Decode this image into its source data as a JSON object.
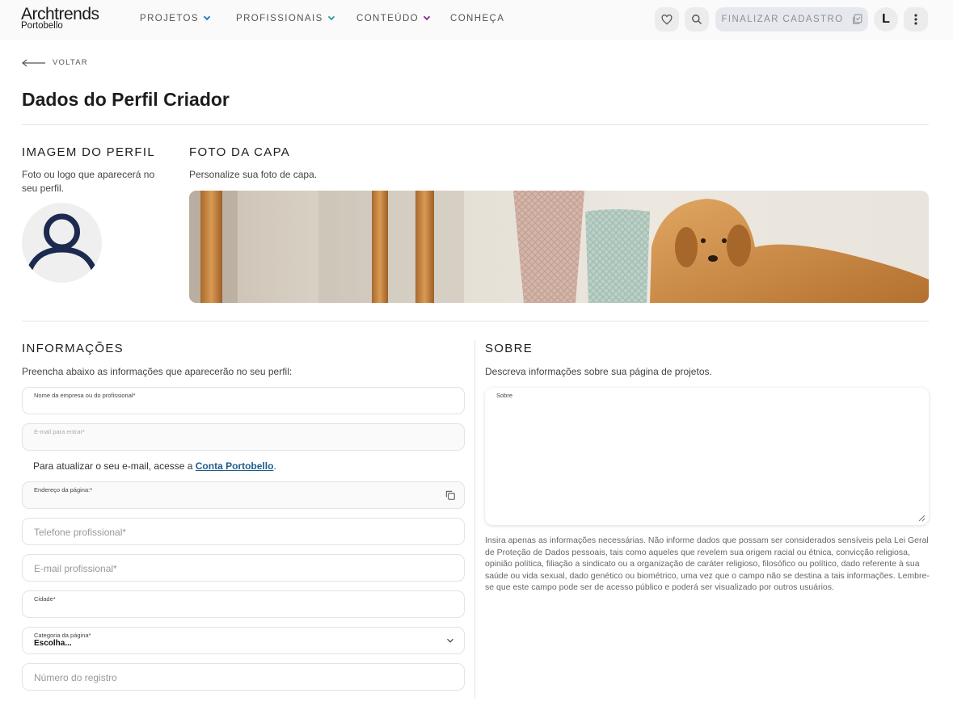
{
  "header": {
    "logo_line1": "Archtrends",
    "logo_line2": "Portobello",
    "nav": [
      {
        "label": "PROJETOS",
        "chevron_color": "#2b7fb8"
      },
      {
        "label": "PROFISSIONAIS",
        "chevron_color": "#3aa39a"
      },
      {
        "label": "CONTEÚDO",
        "chevron_color": "#8a3a8c"
      },
      {
        "label": "CONHEÇA"
      }
    ],
    "finalizar_label": "FINALIZAR CADASTRO",
    "user_initial": "L",
    "icons": [
      "heart-icon",
      "search-icon",
      "checklist-icon",
      "more-vertical-icon"
    ]
  },
  "back_label": "VOLTAR",
  "page_title": "Dados do Perfil Criador",
  "profile_image": {
    "title": "IMAGEM DO PERFIL",
    "desc": "Foto ou logo que aparecerá no seu perfil."
  },
  "cover": {
    "title": "FOTO DA CAPA",
    "desc": "Personalize sua foto de capa."
  },
  "info": {
    "title": "INFORMAÇÕES",
    "desc": "Preencha abaixo as informações que aparecerão no seu perfil:",
    "fields": {
      "company_name": {
        "label": "Nome da empresa ou do profissional*",
        "value": ""
      },
      "login_email": {
        "label": "E-mail para entrar*",
        "value": ""
      },
      "page_address": {
        "label": "Endereço da página:*",
        "value": ""
      },
      "phone": {
        "placeholder": "Telefone profissional*"
      },
      "pro_email": {
        "placeholder": "E-mail profissional*"
      },
      "city": {
        "label": "Cidade*",
        "value": ""
      },
      "category": {
        "label": "Categoria da página*",
        "value": "Escolha..."
      },
      "registry": {
        "placeholder": "Número do registro"
      }
    },
    "email_note_prefix": "Para atualizar o seu e-mail, acesse a ",
    "email_note_link": "Conta Portobello",
    "email_note_suffix": "."
  },
  "about": {
    "title": "SOBRE",
    "desc": "Descreva informações sobre sua página de projetos.",
    "textarea_label": "Sobre",
    "legal": "Insira apenas as informações necessárias. Não informe dados que possam ser considerados sensíveis pela Lei Geral de Proteção de Dados pessoais, tais como aqueles que revelem sua origem racial ou étnica, convicção religiosa, opinião política, filiação a sindicato ou a organização de caráter religioso, filosófico ou político, dado referente à sua saúde ou vida sexual, dado genético ou biométrico, uma vez que o campo não se destina a tais informações. Lembre-se que este campo pode ser de acesso público e poderá ser visualizado por outros usuários."
  }
}
